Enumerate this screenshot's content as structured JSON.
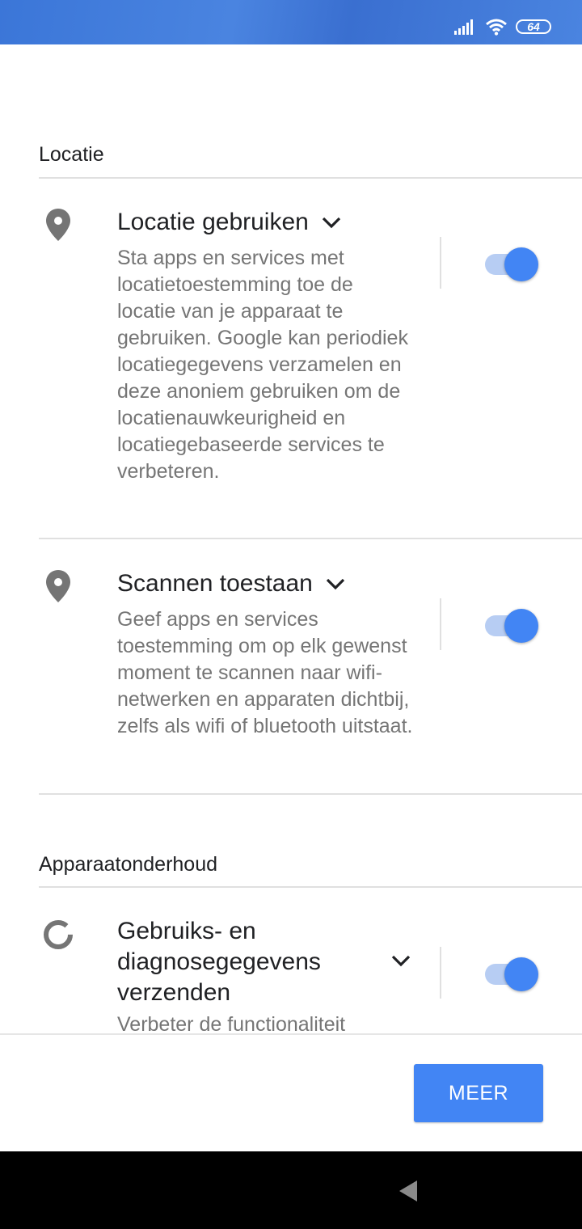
{
  "status_bar": {
    "battery": "64",
    "signal_icon": "signal-icon",
    "wifi_icon": "wifi-icon"
  },
  "sections": {
    "location": {
      "header": "Locatie"
    },
    "maintenance": {
      "header": "Apparaatonderhoud"
    }
  },
  "settings": {
    "use_location": {
      "title": "Locatie gebruiken",
      "description": "Sta apps en services met locatietoestemming toe de locatie van je apparaat te gebruiken. Google kan periodiek locatiegegevens verzamelen en deze anoniem gebruiken om de locatienauwkeurigheid en locatiegebaseerde services te verbeteren.",
      "enabled": true,
      "icon": "location-pin-icon"
    },
    "allow_scanning": {
      "title": "Scannen toestaan",
      "description": "Geef apps en services toestemming om op elk gewenst moment te scannen naar wifi-netwerken en apparaten dichtbij, zelfs als wifi of bluetooth uitstaat.",
      "enabled": true,
      "icon": "location-pin-icon"
    },
    "usage_diagnostics": {
      "title": "Gebruiks- en diagnosegegevens verzenden",
      "description": "Verbeter de functionaliteit",
      "enabled": true,
      "icon": "diagnostics-ring-icon"
    }
  },
  "footer": {
    "more_label": "MEER"
  },
  "colors": {
    "accent": "#4285f4",
    "status_bar": "#3b76d8"
  }
}
